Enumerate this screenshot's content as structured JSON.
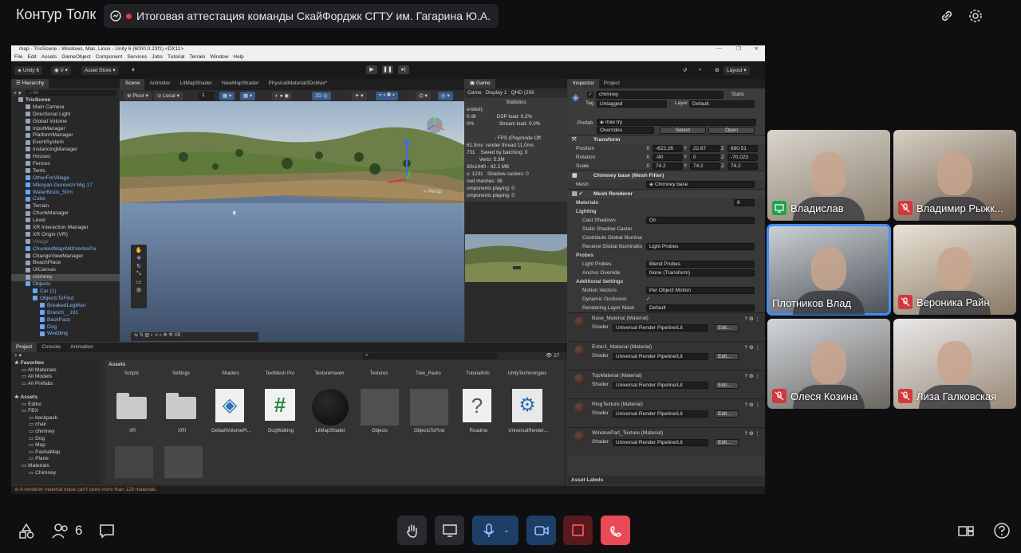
{
  "app": {
    "name": "Контур Толк"
  },
  "meeting": {
    "title": "Итоговая аттестация команды СкайФорджк СГТУ им. Гагарина Ю.А."
  },
  "unity": {
    "window_title": "map - TrisScene - Windows, Mac, Linux - Unity 6 (6000.0.23f1) <DX11>",
    "menu": [
      "File",
      "Edit",
      "Assets",
      "GameObject",
      "Component",
      "Services",
      "Jobs",
      "Tutorial",
      "Terrain",
      "Window",
      "Help"
    ],
    "toolbar": {
      "version": "Unity 6",
      "account": "V",
      "asset_store": "Asset Store",
      "layout": "Layout"
    },
    "hierarchy": {
      "tab": "Hierarchy",
      "search": "All",
      "items": [
        {
          "label": "TrisScene",
          "indent": 1,
          "style": "scene"
        },
        {
          "label": "Main Camera",
          "indent": 2,
          "style": ""
        },
        {
          "label": "Directional Light",
          "indent": 2,
          "style": ""
        },
        {
          "label": "Global Volume",
          "indent": 2,
          "style": ""
        },
        {
          "label": "InputManager",
          "indent": 2,
          "style": ""
        },
        {
          "label": "PlatformManager",
          "indent": 2,
          "style": ""
        },
        {
          "label": "EventSystem",
          "indent": 2,
          "style": ""
        },
        {
          "label": "InstancingManager",
          "indent": 2,
          "style": ""
        },
        {
          "label": "Houses",
          "indent": 2,
          "style": ""
        },
        {
          "label": "Fences",
          "indent": 2,
          "style": ""
        },
        {
          "label": "Tents",
          "indent": 2,
          "style": ""
        },
        {
          "label": "OtherForVillage",
          "indent": 2,
          "style": "blue"
        },
        {
          "label": "Mikoyan-Gurevich Mig 17",
          "indent": 2,
          "style": "blue"
        },
        {
          "label": "WaterBlock_50m",
          "indent": 2,
          "style": "blue"
        },
        {
          "label": "Cube",
          "indent": 2,
          "style": "blue"
        },
        {
          "label": "Terrain",
          "indent": 2,
          "style": ""
        },
        {
          "label": "ChunkManager",
          "indent": 2,
          "style": ""
        },
        {
          "label": "Level",
          "indent": 2,
          "style": ""
        },
        {
          "label": "XR Interaction Manager",
          "indent": 2,
          "style": ""
        },
        {
          "label": "XR Origin (VR)",
          "indent": 2,
          "style": ""
        },
        {
          "label": "Village",
          "indent": 2,
          "style": "dim"
        },
        {
          "label": "ChunkedMapWithVertexPa",
          "indent": 2,
          "style": "blue"
        },
        {
          "label": "ChangeViewManager",
          "indent": 2,
          "style": ""
        },
        {
          "label": "BeachPlace",
          "indent": 2,
          "style": ""
        },
        {
          "label": "UICanvas",
          "indent": 2,
          "style": ""
        },
        {
          "label": "chimney",
          "indent": 2,
          "style": "sel"
        },
        {
          "label": "Objects",
          "indent": 2,
          "style": "blue"
        },
        {
          "label": "Car (1)",
          "indent": 3,
          "style": "blue"
        },
        {
          "label": "ObjectsToFind",
          "indent": 3,
          "style": "blue"
        },
        {
          "label": "BreakedLegMan",
          "indent": 4,
          "style": "blue"
        },
        {
          "label": "Branch__191",
          "indent": 4,
          "style": "blue"
        },
        {
          "label": "BackPack",
          "indent": 4,
          "style": "blue"
        },
        {
          "label": "Dog",
          "indent": 4,
          "style": "blue"
        },
        {
          "label": "Wedding",
          "indent": 4,
          "style": "blue"
        }
      ]
    },
    "scene_tabs": [
      "Scene",
      "Animator",
      "LitMapShader",
      "NewMapShader",
      "PhysicalMaterial3DsMax*"
    ],
    "scene_toolbar": {
      "pivot": "Pivot",
      "local": "Local",
      "grid": "1"
    },
    "scene_gizmo_label": "< Persp",
    "game": {
      "tab": "Game",
      "display_mode": "Game",
      "display": "Display 1",
      "resolution": "QHD (256",
      "stats_title": "Statistics",
      "stats_lines": [
        "ended):",
        "0 dll               DSP load: 0.2%",
        "0%                  Stream load: 0.0%",
        "",
        "                    - FPS (Playmode Off",
        "61.0ms  render thread 11.0ms",
        "731    Saved by batching: 0",
        "         Verts: 5.3M",
        "30x1440 - 42.2 MB",
        "s: 1231   Shadow casters: 0",
        "ned meshes: 36",
        "omponents playing: 0",
        "omponents playing: 0"
      ]
    },
    "inspector": {
      "tabs": [
        "Inspector",
        "Project"
      ],
      "object_name": "chimney",
      "static": "Static",
      "tag_label": "Tag",
      "tag": "Untagged",
      "layer_label": "Layer",
      "layer": "Default",
      "prefab_label": "Prefab",
      "prefab": "max try",
      "overrides": "Overrides",
      "select": "Select",
      "open": "Open",
      "transform": {
        "title": "Transform",
        "position_label": "Position",
        "position": [
          "-622.26",
          "22.67",
          "680.51"
        ],
        "rotation_label": "Rotation",
        "rotation": [
          "-90",
          "0",
          "-70.023"
        ],
        "scale_label": "Scale",
        "scale": [
          "74.2",
          "74.2",
          "74.2"
        ],
        "axis": [
          "X",
          "Y",
          "Z"
        ]
      },
      "mesh_filter": {
        "title": "Chimney base (Mesh Filter)",
        "mesh_label": "Mesh",
        "mesh": "Chimney base"
      },
      "mesh_renderer": {
        "title": "Mesh Renderer",
        "materials_label": "Materials",
        "materials_count": "6",
        "lighting": "Lighting",
        "cast_shadows_label": "Cast Shadows",
        "cast_shadows": "On",
        "static_shadow": "Static Shadow Caster",
        "contribute_gi": "Contribute Global Illumina",
        "receive_gi_label": "Receive Global Illuminatio",
        "receive_gi": "Light Probes",
        "probes": "Probes",
        "light_probes_label": "Light Probes",
        "light_probes": "Blend Probes",
        "anchor_label": "Anchor Override",
        "anchor": "None (Transform)",
        "additional": "Additional Settings",
        "motion_label": "Motion Vectors",
        "motion": "Per Object Motion",
        "occlusion_label": "Dynamic Occlusion",
        "layer_mask_label": "Rendering Layer Mask",
        "layer_mask": "Default"
      },
      "materials": [
        {
          "name": "Base_Material (Material)"
        },
        {
          "name": "Enter1_Material (Material)"
        },
        {
          "name": "TopMaterial (Material)"
        },
        {
          "name": "RingTexture (Material)"
        },
        {
          "name": "WindowPart_Texture (Material)"
        }
      ],
      "shader_label": "Shader",
      "shader_value": "Universal Render Pipeline/Lit",
      "edit_label": "Edit...",
      "asset_labels": "Asset Labels"
    },
    "project": {
      "tabs": [
        "Project",
        "Console",
        "Animation"
      ],
      "hidden_count": "27",
      "tree": [
        {
          "label": "Favorites",
          "indent": 0,
          "bold": true
        },
        {
          "label": "All Materials",
          "indent": 1,
          "bold": false
        },
        {
          "label": "All Models",
          "indent": 1,
          "bold": false
        },
        {
          "label": "All Prefabs",
          "indent": 1,
          "bold": false
        },
        {
          "label": "",
          "indent": 0,
          "bold": false
        },
        {
          "label": "Assets",
          "indent": 0,
          "bold": true
        },
        {
          "label": "Editor",
          "indent": 1,
          "bold": false
        },
        {
          "label": "FBX",
          "indent": 1,
          "bold": false
        },
        {
          "label": "backpack",
          "indent": 2,
          "bold": false
        },
        {
          "label": "chair",
          "indent": 2,
          "bold": false
        },
        {
          "label": "chimney",
          "indent": 2,
          "bold": false
        },
        {
          "label": "Dog",
          "indent": 2,
          "bold": false
        },
        {
          "label": "Map",
          "indent": 2,
          "bold": false
        },
        {
          "label": "PashaMap",
          "indent": 2,
          "bold": false
        },
        {
          "label": "Plane",
          "indent": 2,
          "bold": false
        },
        {
          "label": "Materials",
          "indent": 1,
          "bold": false
        },
        {
          "label": "Chimney",
          "indent": 2,
          "bold": false
        }
      ],
      "breadcrumb": "Assets",
      "top_folders": [
        "Scripts",
        "Settings",
        "Shaders",
        "TextMesh Pro",
        "TextureHaven",
        "Textures",
        "Tree_Packs",
        "TutorialInfo",
        "UnityTechnologies"
      ],
      "assets": [
        {
          "label": "XR",
          "kind": "folder"
        },
        {
          "label": "XRI",
          "kind": "folder"
        },
        {
          "label": "DefaultVolumePr...",
          "kind": "volume"
        },
        {
          "label": "DogWalking",
          "kind": "script"
        },
        {
          "label": "LitMapShader",
          "kind": "sphere"
        },
        {
          "label": "Objects",
          "kind": "gray"
        },
        {
          "label": "ObjectsToFind",
          "kind": "gray"
        },
        {
          "label": "Readme",
          "kind": "readme"
        },
        {
          "label": "UniversalRender...",
          "kind": "urp"
        }
      ]
    },
    "status": "A renderer material mask can't store more than 128 materials."
  },
  "participants": [
    {
      "name": "Владислав",
      "status": "screen",
      "active": false
    },
    {
      "name": "Владимир Рыжк...",
      "status": "muted",
      "active": false
    },
    {
      "name": "Плотников Влад",
      "status": "none",
      "active": true
    },
    {
      "name": "Вероника Райн",
      "status": "muted",
      "active": false
    },
    {
      "name": "Олеся Козина",
      "status": "muted",
      "active": false
    },
    {
      "name": "Лиза Галковская",
      "status": "muted",
      "active": false
    }
  ],
  "bottom": {
    "participants_count": "6"
  },
  "colors": {
    "accent": "#3e8ef7",
    "muted": "#d2383d",
    "hangup": "#e84b56",
    "mic_active": "#1d3e66"
  }
}
